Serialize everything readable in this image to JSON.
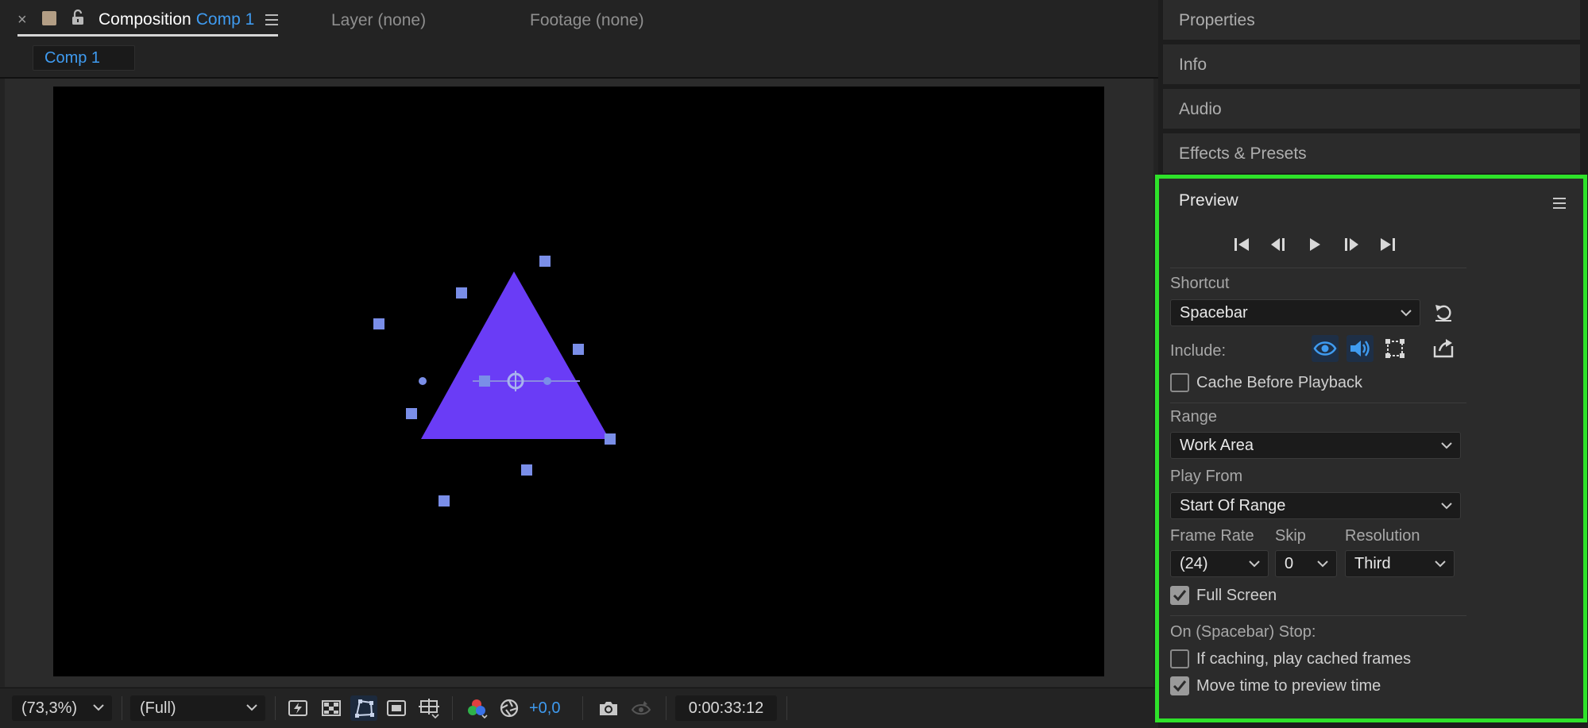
{
  "composition_tab": {
    "close_glyph": "×",
    "title_prefix": "Composition",
    "comp_name": "Comp 1",
    "swatch_color": "#b39e85",
    "layer_tab": "Layer (none)",
    "footage_tab": "Footage (none)",
    "subtab_label": "Comp 1"
  },
  "viewer_toolbar": {
    "zoom": "(73,3%)",
    "resolution": "(Full)",
    "exposure": "+0,0",
    "timecode": "0:00:33:12"
  },
  "right_panels": {
    "properties": "Properties",
    "info": "Info",
    "audio": "Audio",
    "effects_presets": "Effects & Presets"
  },
  "preview": {
    "title": "Preview",
    "shortcut_label": "Shortcut",
    "shortcut_value": "Spacebar",
    "include_label": "Include:",
    "cache_before_playback": "Cache Before Playback",
    "cache_before_playback_checked": false,
    "range_label": "Range",
    "range_value": "Work Area",
    "play_from_label": "Play From",
    "play_from_value": "Start Of Range",
    "frame_rate_label": "Frame Rate",
    "frame_rate_value": "(24)",
    "skip_label": "Skip",
    "skip_value": "0",
    "resolution_label": "Resolution",
    "resolution_value": "Third",
    "full_screen": "Full Screen",
    "full_screen_checked": true,
    "stop_label": "On (Spacebar) Stop:",
    "if_caching": "If caching, play cached frames",
    "if_caching_checked": false,
    "move_time": "Move time to preview time",
    "move_time_checked": true,
    "highlight_color": "#2ee22a"
  },
  "colors": {
    "accent_blue": "#3f9bf0",
    "shape_fill": "#6a3cf6",
    "handle_color": "#7a8ee8"
  }
}
